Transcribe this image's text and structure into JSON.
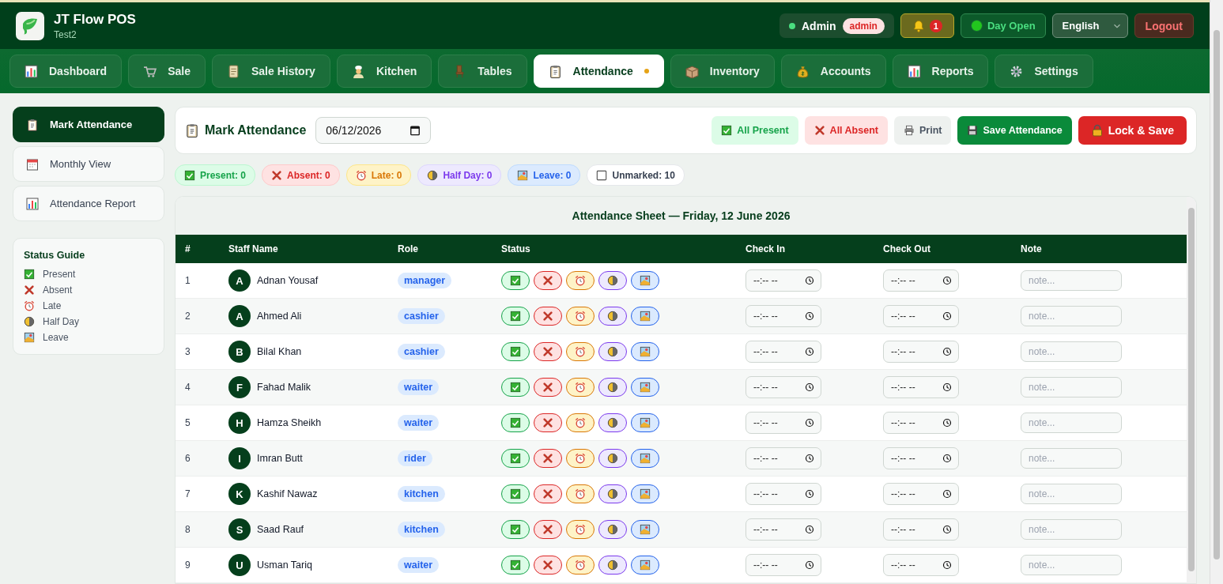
{
  "app": {
    "title": "JT Flow POS",
    "subtitle": "Test2"
  },
  "user": {
    "name": "Admin",
    "role": "admin",
    "online": true
  },
  "notifications": {
    "count": "1"
  },
  "day_status": {
    "label": "Day Open",
    "open": true
  },
  "language": {
    "value": "English"
  },
  "logout": {
    "label": "Logout"
  },
  "nav_tabs": [
    {
      "label": "Dashboard",
      "selected": false
    },
    {
      "label": "Sale",
      "selected": false
    },
    {
      "label": "Sale History",
      "selected": false
    },
    {
      "label": "Kitchen",
      "selected": false
    },
    {
      "label": "Tables",
      "selected": false
    },
    {
      "label": "Attendance",
      "selected": true
    },
    {
      "label": "Inventory",
      "selected": false
    },
    {
      "label": "Accounts",
      "selected": false
    },
    {
      "label": "Reports",
      "selected": false
    },
    {
      "label": "Settings",
      "selected": false
    }
  ],
  "sidebar": {
    "items": [
      {
        "label": "Mark Attendance",
        "selected": true
      },
      {
        "label": "Monthly View",
        "selected": false
      },
      {
        "label": "Attendance Report",
        "selected": false
      }
    ],
    "guide": {
      "title": "Status Guide",
      "items": [
        {
          "kind": "present",
          "label": "Present"
        },
        {
          "kind": "absent",
          "label": "Absent"
        },
        {
          "kind": "late",
          "label": "Late"
        },
        {
          "kind": "half_day",
          "label": "Half Day"
        },
        {
          "kind": "leave",
          "label": "Leave"
        }
      ]
    }
  },
  "toolbar": {
    "title": "Mark Attendance",
    "date": "06/12/2026",
    "buttons": [
      {
        "kind": "all_present",
        "label": "All Present"
      },
      {
        "kind": "all_absent",
        "label": "All Absent"
      },
      {
        "kind": "print",
        "label": "Print"
      },
      {
        "kind": "save",
        "label": "Save Attendance"
      },
      {
        "kind": "lock",
        "label": "Lock & Save"
      }
    ]
  },
  "summary": [
    {
      "kind": "present",
      "label": "Present: 0"
    },
    {
      "kind": "absent",
      "label": "Absent: 0"
    },
    {
      "kind": "late",
      "label": "Late: 0"
    },
    {
      "kind": "half_day",
      "label": "Half Day: 0"
    },
    {
      "kind": "leave",
      "label": "Leave: 0"
    },
    {
      "kind": "unmarked",
      "label": "Unmarked: 10"
    }
  ],
  "sheet": {
    "title": "Attendance Sheet — Friday, 12 June 2026",
    "columns": [
      "#",
      "Staff Name",
      "Role",
      "Status",
      "Check In",
      "Check Out",
      "Note"
    ],
    "rows": [
      {
        "num": "1",
        "initial": "A",
        "name": "Adnan Yousaf",
        "role": "manager",
        "statuses": [
          {
            "kind": "present",
            "selected": false
          },
          {
            "kind": "absent",
            "selected": false
          },
          {
            "kind": "late",
            "selected": false
          },
          {
            "kind": "half_day",
            "selected": false
          },
          {
            "kind": "leave",
            "selected": false
          }
        ],
        "check_in": {
          "placeholder": "--:-- --"
        },
        "check_out": {
          "placeholder": "--:-- --"
        },
        "note": {
          "placeholder": "note..."
        }
      },
      {
        "num": "2",
        "initial": "A",
        "name": "Ahmed Ali",
        "role": "cashier",
        "statuses": [
          {
            "kind": "present",
            "selected": false
          },
          {
            "kind": "absent",
            "selected": false
          },
          {
            "kind": "late",
            "selected": false
          },
          {
            "kind": "half_day",
            "selected": false
          },
          {
            "kind": "leave",
            "selected": false
          }
        ],
        "check_in": {
          "placeholder": "--:-- --"
        },
        "check_out": {
          "placeholder": "--:-- --"
        },
        "note": {
          "placeholder": "note..."
        }
      },
      {
        "num": "3",
        "initial": "B",
        "name": "Bilal Khan",
        "role": "cashier",
        "statuses": [
          {
            "kind": "present",
            "selected": false
          },
          {
            "kind": "absent",
            "selected": false
          },
          {
            "kind": "late",
            "selected": false
          },
          {
            "kind": "half_day",
            "selected": false
          },
          {
            "kind": "leave",
            "selected": false
          }
        ],
        "check_in": {
          "placeholder": "--:-- --"
        },
        "check_out": {
          "placeholder": "--:-- --"
        },
        "note": {
          "placeholder": "note..."
        }
      },
      {
        "num": "4",
        "initial": "F",
        "name": "Fahad Malik",
        "role": "waiter",
        "statuses": [
          {
            "kind": "present",
            "selected": false
          },
          {
            "kind": "absent",
            "selected": false
          },
          {
            "kind": "late",
            "selected": false
          },
          {
            "kind": "half_day",
            "selected": false
          },
          {
            "kind": "leave",
            "selected": false
          }
        ],
        "check_in": {
          "placeholder": "--:-- --"
        },
        "check_out": {
          "placeholder": "--:-- --"
        },
        "note": {
          "placeholder": "note..."
        }
      },
      {
        "num": "5",
        "initial": "H",
        "name": "Hamza Sheikh",
        "role": "waiter",
        "statuses": [
          {
            "kind": "present",
            "selected": false
          },
          {
            "kind": "absent",
            "selected": false
          },
          {
            "kind": "late",
            "selected": false
          },
          {
            "kind": "half_day",
            "selected": false
          },
          {
            "kind": "leave",
            "selected": false
          }
        ],
        "check_in": {
          "placeholder": "--:-- --"
        },
        "check_out": {
          "placeholder": "--:-- --"
        },
        "note": {
          "placeholder": "note..."
        }
      },
      {
        "num": "6",
        "initial": "I",
        "name": "Imran Butt",
        "role": "rider",
        "statuses": [
          {
            "kind": "present",
            "selected": false
          },
          {
            "kind": "absent",
            "selected": false
          },
          {
            "kind": "late",
            "selected": false
          },
          {
            "kind": "half_day",
            "selected": false
          },
          {
            "kind": "leave",
            "selected": false
          }
        ],
        "check_in": {
          "placeholder": "--:-- --"
        },
        "check_out": {
          "placeholder": "--:-- --"
        },
        "note": {
          "placeholder": "note..."
        }
      },
      {
        "num": "7",
        "initial": "K",
        "name": "Kashif Nawaz",
        "role": "kitchen",
        "statuses": [
          {
            "kind": "present",
            "selected": false
          },
          {
            "kind": "absent",
            "selected": false
          },
          {
            "kind": "late",
            "selected": false
          },
          {
            "kind": "half_day",
            "selected": false
          },
          {
            "kind": "leave",
            "selected": false
          }
        ],
        "check_in": {
          "placeholder": "--:-- --"
        },
        "check_out": {
          "placeholder": "--:-- --"
        },
        "note": {
          "placeholder": "note..."
        }
      },
      {
        "num": "8",
        "initial": "S",
        "name": "Saad Rauf",
        "role": "kitchen",
        "statuses": [
          {
            "kind": "present",
            "selected": false
          },
          {
            "kind": "absent",
            "selected": false
          },
          {
            "kind": "late",
            "selected": false
          },
          {
            "kind": "half_day",
            "selected": false
          },
          {
            "kind": "leave",
            "selected": false
          }
        ],
        "check_in": {
          "placeholder": "--:-- --"
        },
        "check_out": {
          "placeholder": "--:-- --"
        },
        "note": {
          "placeholder": "note..."
        }
      },
      {
        "num": "9",
        "initial": "U",
        "name": "Usman Tariq",
        "role": "waiter",
        "statuses": [
          {
            "kind": "present",
            "selected": false
          },
          {
            "kind": "absent",
            "selected": false
          },
          {
            "kind": "late",
            "selected": false
          },
          {
            "kind": "half_day",
            "selected": false
          },
          {
            "kind": "leave",
            "selected": false
          }
        ],
        "check_in": {
          "placeholder": "--:-- --"
        },
        "check_out": {
          "placeholder": "--:-- --"
        },
        "note": {
          "placeholder": "note..."
        }
      }
    ]
  }
}
